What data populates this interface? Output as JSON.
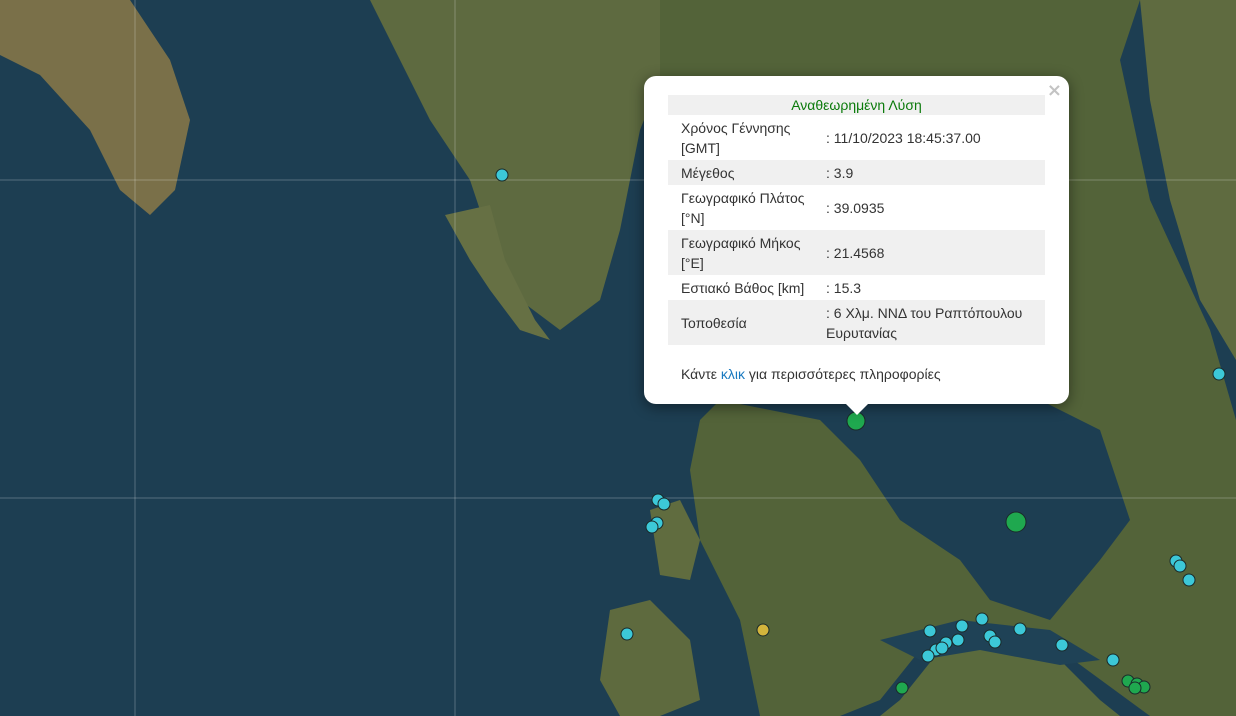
{
  "popup": {
    "title": "Αναθεωρημένη Λύση",
    "close_symbol": "×",
    "rows": [
      {
        "label": "Χρόνος Γέννησης [GMT]",
        "value": ": 11/10/2023 18:45:37.00"
      },
      {
        "label": "Μέγεθος",
        "value": ": 3.9"
      },
      {
        "label": "Γεωγραφικό Πλάτος [°N]",
        "value": ": 39.0935"
      },
      {
        "label": "Γεωγραφικό Μήκος [°E]",
        "value": ": 21.4568"
      },
      {
        "label": "Εστιακό Βάθος [km]",
        "value": ": 15.3"
      },
      {
        "label": "Τοποθεσία",
        "value": ": 6 Χλμ. ΝΝΔ του Ραπτόπουλου Ευρυτανίας"
      }
    ],
    "more_prefix": "Κάντε ",
    "more_link": "κλιк",
    "more_suffix": " για περισσότερες πληροφορίες"
  },
  "colors": {
    "sea": "#1d3e52",
    "land": "#5d6b3f",
    "marker_cyan": "#3cc8d8",
    "marker_green": "#1fa84f",
    "marker_yellow": "#d2b43c",
    "title_green": "#0a7a0a",
    "link": "#1a7ac0"
  }
}
